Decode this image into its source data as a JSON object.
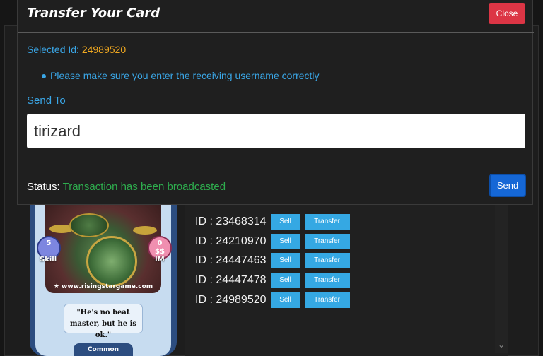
{
  "modal": {
    "title": "Transfer Your Card",
    "close_label": "Close",
    "selected_label": "Selected Id:",
    "selected_value": "24989520",
    "note": "Please make sure you enter the receiving username correctly",
    "sendto_label": "Send To",
    "sendto_value": "tirizard",
    "status_label": "Status:",
    "status_value": "Transaction has been broadcasted",
    "send_label": "Send"
  },
  "card": {
    "skill_value": "5",
    "skill_label": "Skill",
    "im_value": "0",
    "im_label": "IM",
    "im_symbol": "$$",
    "website": "www.risingstargame.com",
    "quote": "\"He's no beat master, but he is ok.\"",
    "rarity": "Common"
  },
  "cards_list": {
    "sell_label": "Sell",
    "transfer_label": "Transfer",
    "items": [
      {
        "id_text": "ID : 23468314"
      },
      {
        "id_text": "ID : 24210970"
      },
      {
        "id_text": "ID : 24447463"
      },
      {
        "id_text": "ID : 24447478"
      },
      {
        "id_text": "ID : 24989520"
      }
    ]
  },
  "colors": {
    "accent_blue": "#3aa6e6",
    "selected_orange": "#f0a820",
    "status_green": "#2eae4e",
    "close_red": "#dc3545",
    "send_blue": "#1567d6",
    "small_button_blue": "#35a8e3"
  }
}
